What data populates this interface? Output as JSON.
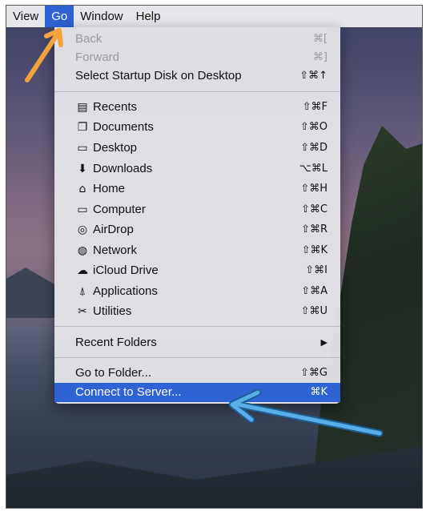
{
  "menubar": {
    "items": [
      "View",
      "Go",
      "Window",
      "Help"
    ]
  },
  "menu": {
    "back": {
      "label": "Back",
      "shortcut": "⌘["
    },
    "forward": {
      "label": "Forward",
      "shortcut": "⌘]"
    },
    "startup": {
      "label": "Select Startup Disk on Desktop",
      "shortcut": "⇧⌘↑"
    },
    "recents": {
      "label": "Recents",
      "shortcut": "⇧⌘F"
    },
    "documents": {
      "label": "Documents",
      "shortcut": "⇧⌘O"
    },
    "desktop": {
      "label": "Desktop",
      "shortcut": "⇧⌘D"
    },
    "downloads": {
      "label": "Downloads",
      "shortcut": "⌥⌘L"
    },
    "home": {
      "label": "Home",
      "shortcut": "⇧⌘H"
    },
    "computer": {
      "label": "Computer",
      "shortcut": "⇧⌘C"
    },
    "airdrop": {
      "label": "AirDrop",
      "shortcut": "⇧⌘R"
    },
    "network": {
      "label": "Network",
      "shortcut": "⇧⌘K"
    },
    "icloud": {
      "label": "iCloud Drive",
      "shortcut": "⇧⌘I"
    },
    "applications": {
      "label": "Applications",
      "shortcut": "⇧⌘A"
    },
    "utilities": {
      "label": "Utilities",
      "shortcut": "⇧⌘U"
    },
    "recent_folders": {
      "label": "Recent Folders",
      "shortcut": "▶"
    },
    "go_to_folder": {
      "label": "Go to Folder...",
      "shortcut": "⇧⌘G"
    },
    "connect": {
      "label": "Connect to Server...",
      "shortcut": "⌘K"
    }
  },
  "colors": {
    "highlight": "#2f63d4",
    "orange_arrow": "#f2a33a",
    "blue_arrow": "#5aaee8"
  }
}
